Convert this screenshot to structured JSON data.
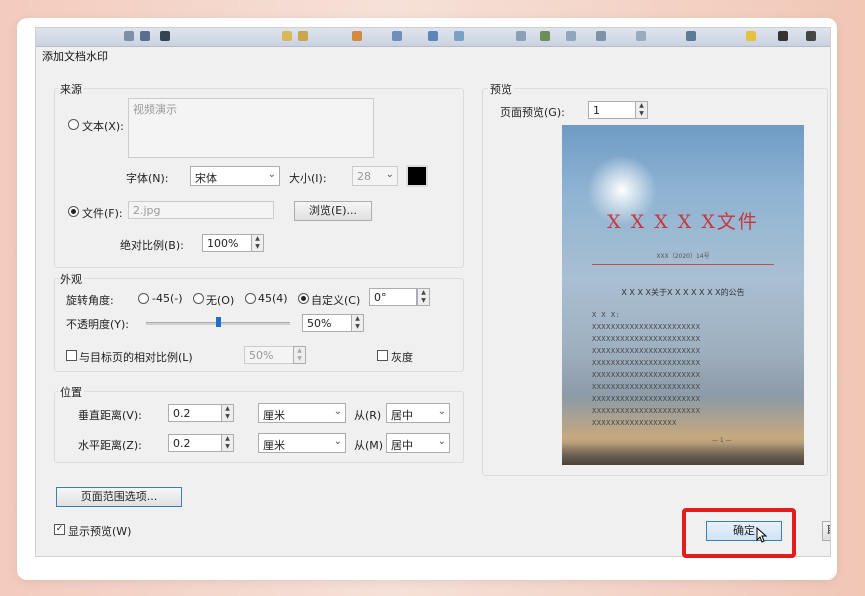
{
  "dialog": {
    "title": "添加文档水印"
  },
  "source": {
    "group_title": "来源",
    "text_label": "文本(X):",
    "text_value": "视频演示",
    "font_label": "字体(N):",
    "font_value": "宋体",
    "size_label": "大小(I):",
    "size_value": "28",
    "file_label": "文件(F):",
    "file_value": "2.jpg",
    "browse_button": "浏览(E)...",
    "scale_label": "绝对比例(B):",
    "scale_value": "100%",
    "selected": "file"
  },
  "appearance": {
    "group_title": "外观",
    "rotation_label": "旋转角度:",
    "rotation_options": [
      "-45(-)",
      "无(O)",
      "45(4)",
      "自定义(C)"
    ],
    "rotation_selected": "自定义(C)",
    "custom_angle": "0°",
    "opacity_label": "不透明度(Y):",
    "opacity_value": "50%",
    "opacity_level": 0.5,
    "relative_scale_label": "与目标页的相对比例(L)",
    "relative_scale_value": "50%",
    "relative_scale_checked": false,
    "grayscale_label": "灰度",
    "grayscale_checked": false
  },
  "position": {
    "group_title": "位置",
    "vertical_label": "垂直距离(V):",
    "vertical_value": "0.2",
    "vertical_unit": "厘米",
    "vertical_from_label": "从(R)",
    "vertical_from_value": "居中",
    "horizontal_label": "水平距离(Z):",
    "horizontal_value": "0.2",
    "horizontal_unit": "厘米",
    "horizontal_from_label": "从(M)",
    "horizontal_from_value": "居中"
  },
  "page_range_button": "页面范围选项...",
  "show_preview": {
    "label": "显示预览(W)",
    "checked": true
  },
  "preview": {
    "group_title": "预览",
    "page_label": "页面预览(G):",
    "page_value": "1",
    "doc_title": "X X X X X文件",
    "doc_number": "XXX〔2020〕14号",
    "doc_heading": "X X X X关于X X X X X X X的公告",
    "doc_first_line": "X X X:",
    "doc_footer": "— 1 —"
  },
  "buttons": {
    "ok": "确定",
    "cancel_partial": "取"
  },
  "colors": {
    "highlight": "#e31b1b",
    "doc_red": "#c8373c",
    "accent": "#1e6fd0"
  }
}
